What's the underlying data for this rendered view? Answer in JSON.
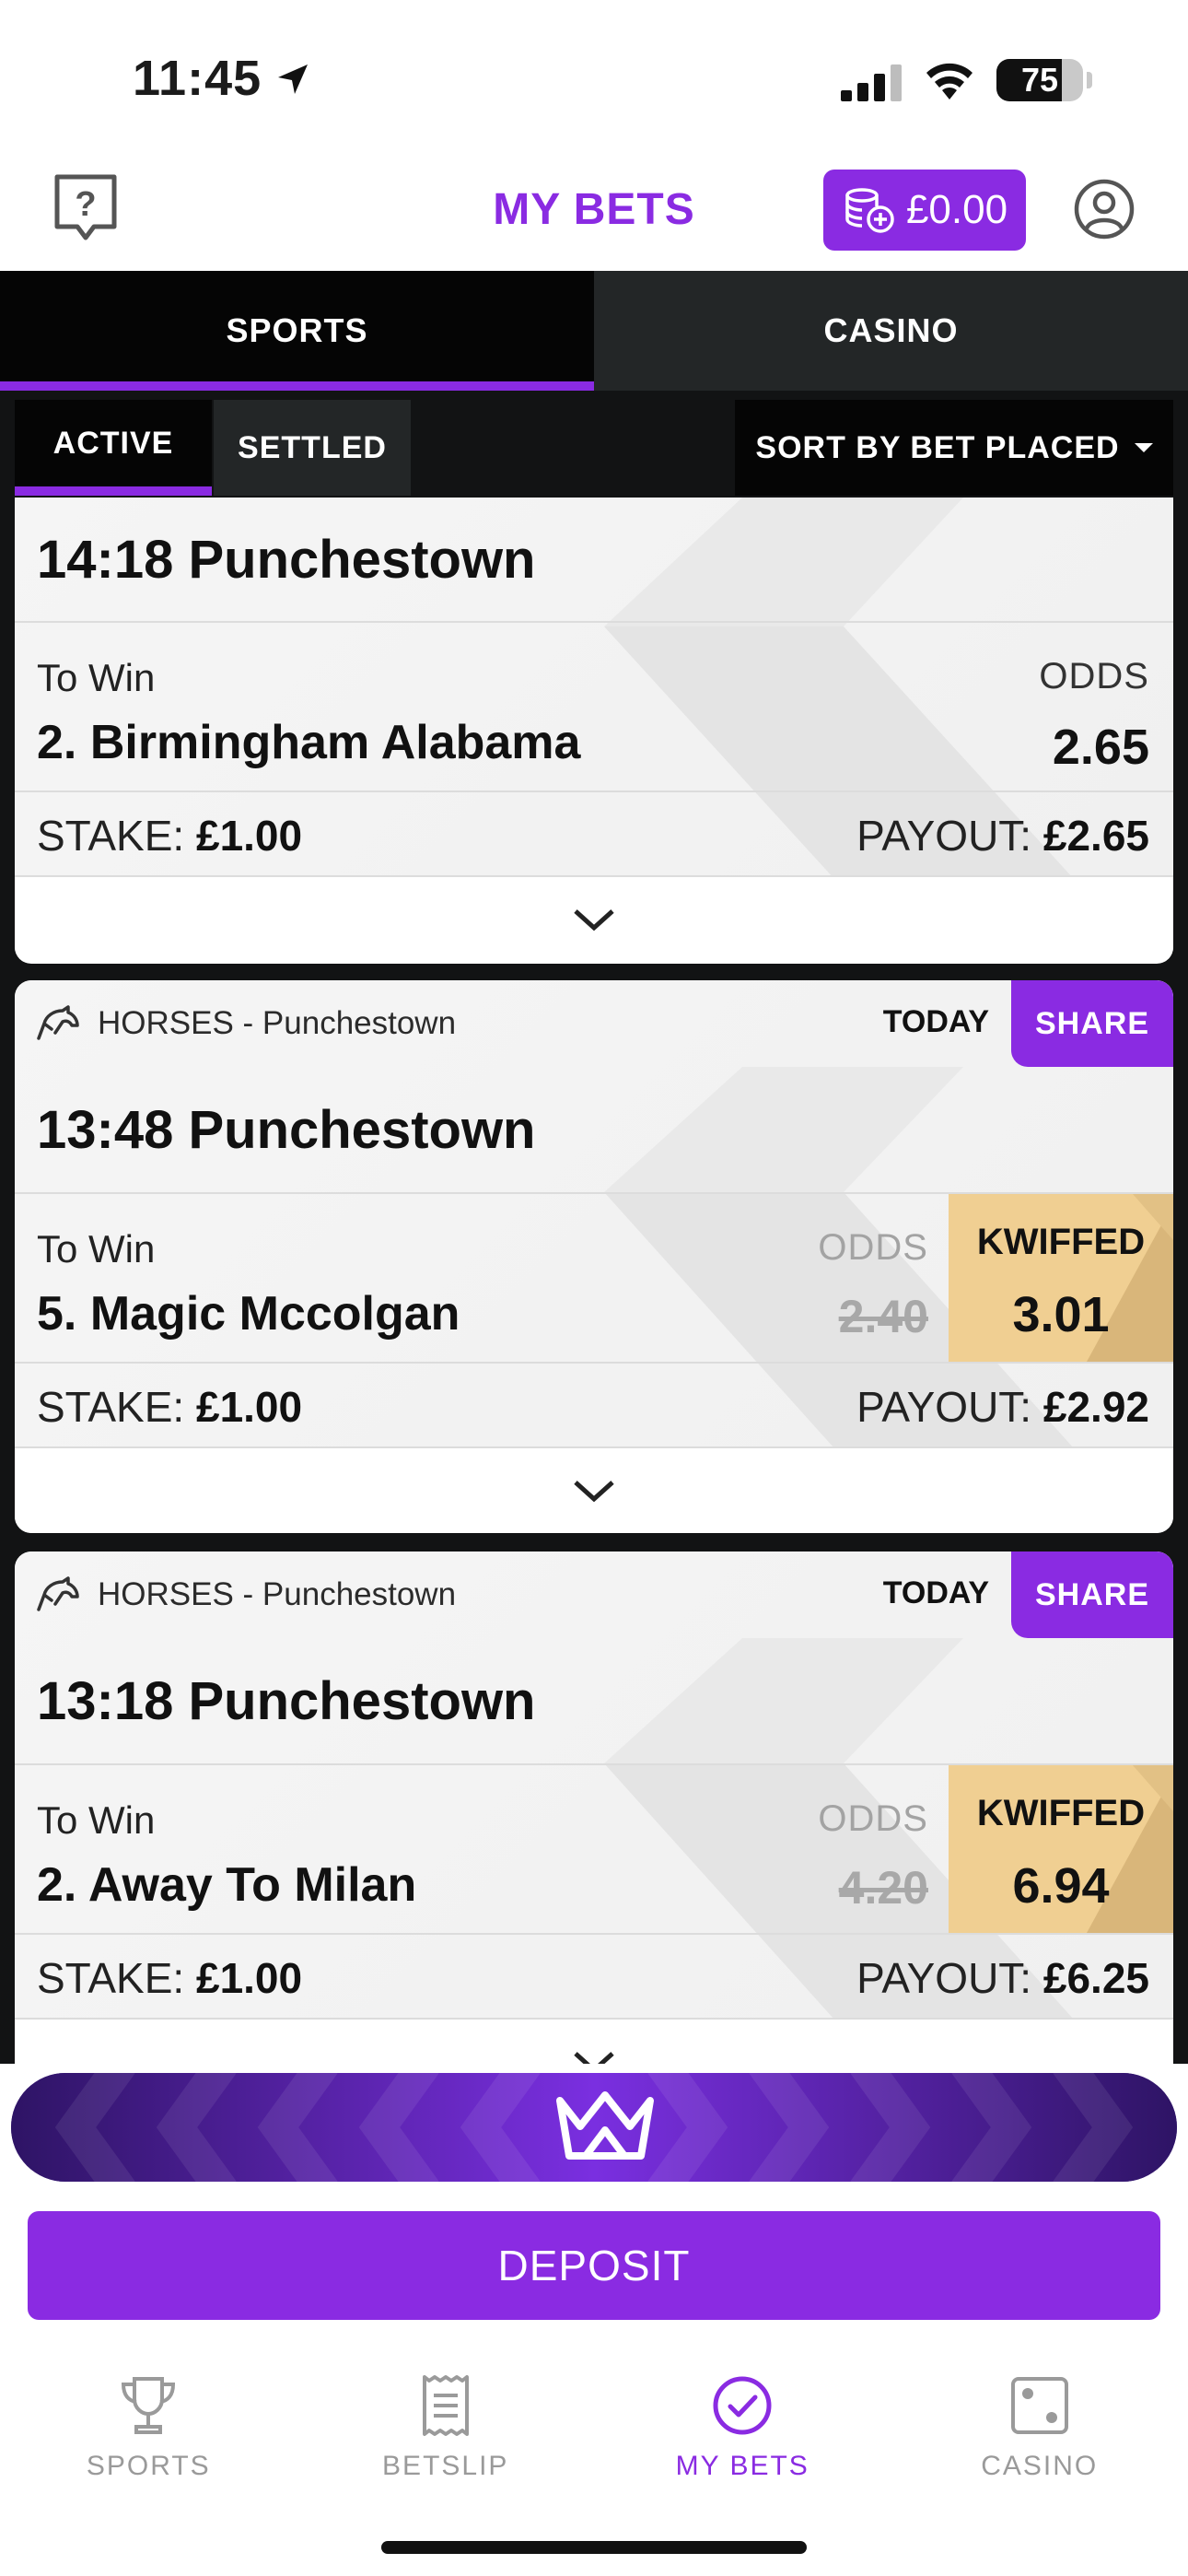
{
  "status_bar": {
    "time": "11:45",
    "battery": "75",
    "battery_level": 0.75
  },
  "header": {
    "title": "MY BETS",
    "balance": "£0.00"
  },
  "main_tabs": [
    "SPORTS",
    "CASINO"
  ],
  "sub_tabs": {
    "active": "ACTIVE",
    "settled": "SETTLED",
    "sort": "SORT BY BET PLACED"
  },
  "bets": [
    {
      "event": "14:18 Punchestown",
      "market": "To Win",
      "selection": "2. Birmingham Alabama",
      "odds_label": "ODDS",
      "odds": "2.65",
      "stake_label": "STAKE:",
      "stake": "£1.00",
      "payout_label": "PAYOUT:",
      "payout": "£2.65"
    },
    {
      "sport": "HORSES - Punchestown",
      "date": "TODAY",
      "share": "SHARE",
      "event": "13:48 Punchestown",
      "market": "To Win",
      "selection": "5. Magic Mccolgan",
      "odds_label": "ODDS",
      "old_odds": "2.40",
      "kwiffed_label": "KWIFFED",
      "kwiffed_odds": "3.01",
      "stake_label": "STAKE:",
      "stake": "£1.00",
      "payout_label": "PAYOUT:",
      "payout": "£2.92"
    },
    {
      "sport": "HORSES - Punchestown",
      "date": "TODAY",
      "share": "SHARE",
      "event": "13:18 Punchestown",
      "market": "To Win",
      "selection": "2. Away To Milan",
      "odds_label": "ODDS",
      "old_odds": "4.20",
      "kwiffed_label": "KWIFFED",
      "kwiffed_odds": "6.94",
      "stake_label": "STAKE:",
      "stake": "£1.00",
      "payout_label": "PAYOUT:",
      "payout": "£6.25"
    }
  ],
  "deposit_label": "DEPOSIT",
  "bottom_nav": [
    {
      "label": "SPORTS",
      "icon": "trophy-icon"
    },
    {
      "label": "BETSLIP",
      "icon": "receipt-icon"
    },
    {
      "label": "MY BETS",
      "icon": "check-circle-icon"
    },
    {
      "label": "CASINO",
      "icon": "dice-icon"
    }
  ],
  "colors": {
    "accent": "#8a2be2",
    "kwiffed": "#f0cf92",
    "dark": "#121314"
  }
}
